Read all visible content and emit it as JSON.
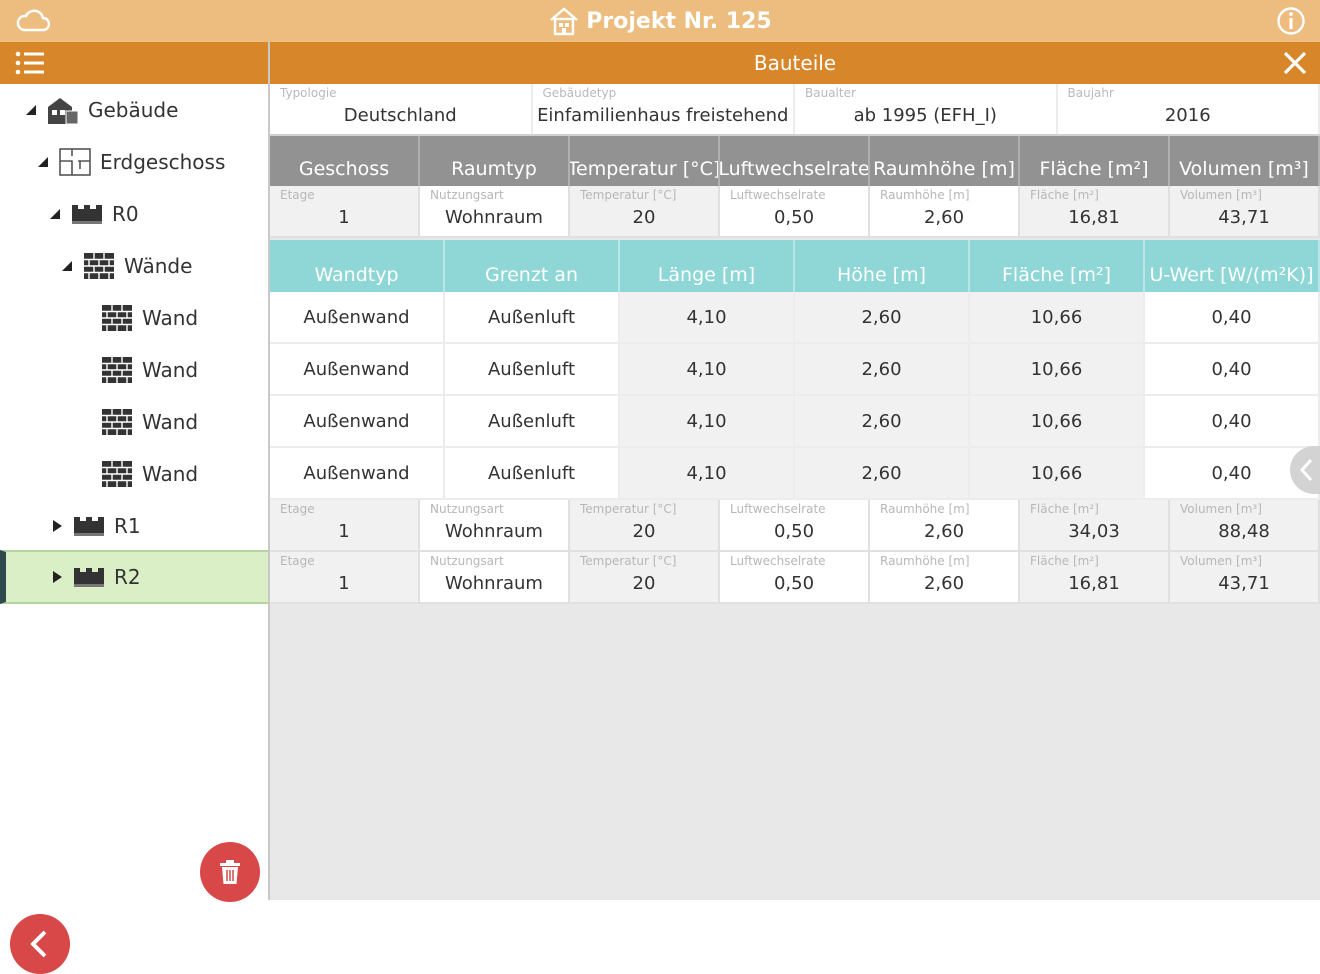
{
  "app": {
    "title": "Projekt Nr. 125",
    "panel_title": "Bauteile",
    "accent_color": "#ecbd7e",
    "bar_color": "#d8862a",
    "danger_color": "#d84848",
    "icons": [
      "cloud-icon",
      "house-icon",
      "info-icon",
      "menu-list-icon",
      "close-icon",
      "trash-icon",
      "back-chevron-icon"
    ]
  },
  "tree": {
    "items": [
      {
        "label": "Gebäude",
        "icon": "building-icon",
        "arrow": "expanded"
      },
      {
        "label": "Erdgeschoss",
        "icon": "floor-plan-icon",
        "arrow": "expanded"
      },
      {
        "label": "R0",
        "icon": "room-icon",
        "arrow": "expanded"
      },
      {
        "label": "Wände",
        "icon": "brick-wall-icon",
        "arrow": "expanded"
      },
      {
        "label": "Wand",
        "icon": "brick-wall-icon",
        "arrow": "none"
      },
      {
        "label": "Wand",
        "icon": "brick-wall-icon",
        "arrow": "none"
      },
      {
        "label": "Wand",
        "icon": "brick-wall-icon",
        "arrow": "none"
      },
      {
        "label": "Wand",
        "icon": "brick-wall-icon",
        "arrow": "none"
      },
      {
        "label": "R1",
        "icon": "room-icon",
        "arrow": "collapsed"
      },
      {
        "label": "R2",
        "icon": "room-icon",
        "arrow": "collapsed",
        "selected": true
      }
    ]
  },
  "info": {
    "typologie_label": "Typologie",
    "typologie": "Deutschland",
    "gebaeudetyp_label": "Gebäudetyp",
    "gebaeudetyp": "Einfamilienhaus freistehend",
    "baualter_label": "Baualter",
    "baualter": "ab 1995 (EFH_I)",
    "baujahr_label": "Baujahr",
    "baujahr": "2016"
  },
  "room_table": {
    "headers": [
      "Geschoss",
      "Raumtyp",
      "Temperatur [°C]",
      "Luftwechselrate",
      "Raumhöhe [m]",
      "Fläche [m²]",
      "Volumen [m³]"
    ],
    "field_labels": [
      "Etage",
      "Nutzungsart",
      "Temperatur [°C]",
      "Luftwechselrate",
      "Raumhöhe [m]",
      "Fläche [m²]",
      "Volumen [m³]"
    ],
    "rows": [
      [
        "1",
        "Wohnraum",
        "20",
        "0,50",
        "2,60",
        "16,81",
        "43,71"
      ],
      [
        "1",
        "Wohnraum",
        "20",
        "0,50",
        "2,60",
        "34,03",
        "88,48"
      ],
      [
        "1",
        "Wohnraum",
        "20",
        "0,50",
        "2,60",
        "16,81",
        "43,71"
      ]
    ]
  },
  "wall_table": {
    "headers": [
      "Wandtyp",
      "Grenzt an",
      "Länge [m]",
      "Höhe [m]",
      "Fläche [m²]",
      "U-Wert [W/(m²K)]"
    ],
    "rows": [
      [
        "Außenwand",
        "Außenluft",
        "4,10",
        "2,60",
        "10,66",
        "0,40"
      ],
      [
        "Außenwand",
        "Außenluft",
        "4,10",
        "2,60",
        "10,66",
        "0,40"
      ],
      [
        "Außenwand",
        "Außenluft",
        "4,10",
        "2,60",
        "10,66",
        "0,40"
      ],
      [
        "Außenwand",
        "Außenluft",
        "4,10",
        "2,60",
        "10,66",
        "0,40"
      ]
    ]
  }
}
